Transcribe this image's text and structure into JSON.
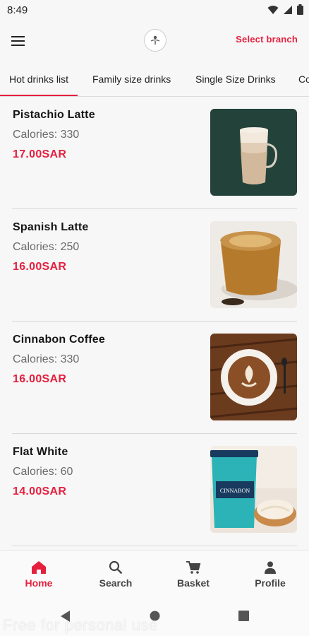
{
  "status_bar": {
    "time": "8:49"
  },
  "header": {
    "select_branch": "Select branch"
  },
  "tabs": [
    {
      "label": "Hot drinks list",
      "active": true
    },
    {
      "label": "Family size drinks",
      "active": false
    },
    {
      "label": "Single Size Drinks",
      "active": false
    },
    {
      "label": "Co",
      "active": false
    }
  ],
  "items": [
    {
      "name": "Pistachio Latte",
      "calories": "Calories: 330",
      "price": "17.00SAR"
    },
    {
      "name": "Spanish Latte",
      "calories": "Calories: 250",
      "price": "16.00SAR"
    },
    {
      "name": "Cinnabon Coffee",
      "calories": "Calories: 330",
      "price": "16.00SAR"
    },
    {
      "name": "Flat White",
      "calories": "Calories: 60",
      "price": "14.00SAR"
    }
  ],
  "cup_brand_text": "CINNABON",
  "bottom_nav": [
    {
      "label": "Home",
      "icon": "home-icon",
      "active": true
    },
    {
      "label": "Search",
      "icon": "search-icon",
      "active": false
    },
    {
      "label": "Basket",
      "icon": "cart-icon",
      "active": false
    },
    {
      "label": "Profile",
      "icon": "person-icon",
      "active": false
    }
  ],
  "watermark": "Free for personal use",
  "colors": {
    "accent": "#e5203f",
    "background": "#f7f7f7"
  }
}
